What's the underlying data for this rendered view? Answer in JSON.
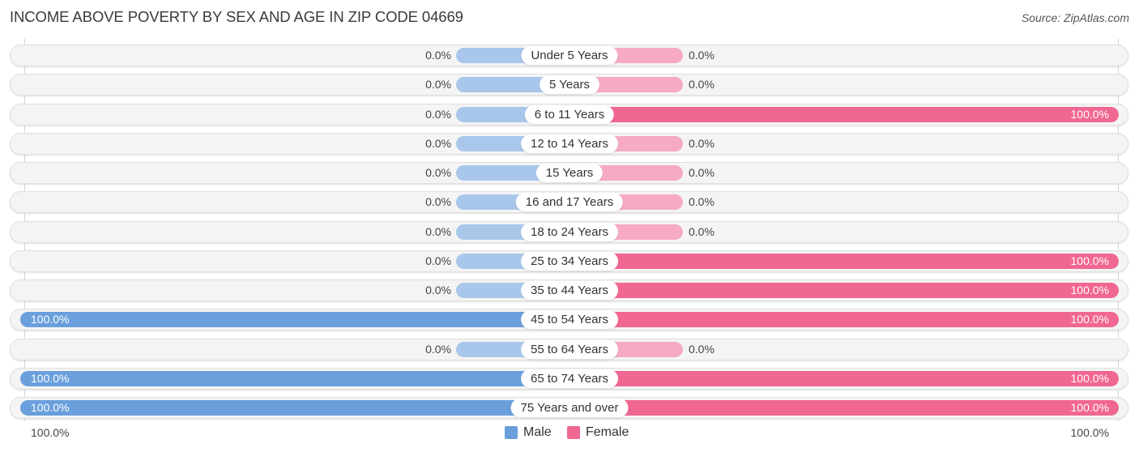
{
  "header": {
    "title": "INCOME ABOVE POVERTY BY SEX AND AGE IN ZIP CODE 04669",
    "source": "Source: ZipAtlas.com"
  },
  "colors": {
    "male": "#6a9fdc",
    "male_light": "#a9c7ea",
    "female": "#f06791",
    "female_light": "#f6aac3"
  },
  "legend": {
    "male": "Male",
    "female": "Female"
  },
  "axis": {
    "left": "100.0%",
    "right": "100.0%"
  },
  "chart_data": {
    "type": "bar",
    "orientation": "horizontal-diverging",
    "title": "INCOME ABOVE POVERTY BY SEX AND AGE IN ZIP CODE 04669",
    "xlim": [
      -100,
      100
    ],
    "legend_position": "bottom",
    "categories": [
      "Under 5 Years",
      "5 Years",
      "6 to 11 Years",
      "12 to 14 Years",
      "15 Years",
      "16 and 17 Years",
      "18 to 24 Years",
      "25 to 34 Years",
      "35 to 44 Years",
      "45 to 54 Years",
      "55 to 64 Years",
      "65 to 74 Years",
      "75 Years and over"
    ],
    "series": [
      {
        "name": "Male",
        "values": [
          0,
          0,
          0,
          0,
          0,
          0,
          0,
          0,
          0,
          100,
          0,
          100,
          100
        ],
        "labels": [
          "0.0%",
          "0.0%",
          "0.0%",
          "0.0%",
          "0.0%",
          "0.0%",
          "0.0%",
          "0.0%",
          "0.0%",
          "100.0%",
          "0.0%",
          "100.0%",
          "100.0%"
        ]
      },
      {
        "name": "Female",
        "values": [
          0,
          0,
          100,
          0,
          0,
          0,
          0,
          100,
          100,
          100,
          0,
          100,
          100
        ],
        "labels": [
          "0.0%",
          "0.0%",
          "100.0%",
          "0.0%",
          "0.0%",
          "0.0%",
          "0.0%",
          "100.0%",
          "100.0%",
          "100.0%",
          "0.0%",
          "100.0%",
          "100.0%"
        ]
      }
    ]
  }
}
